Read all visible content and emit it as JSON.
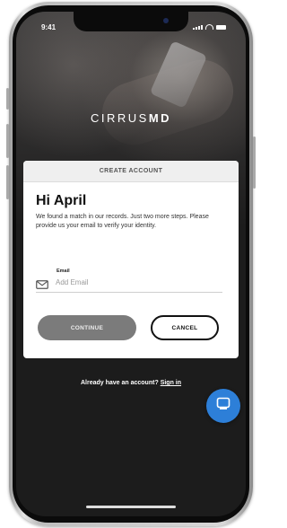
{
  "status_bar": {
    "time": "9:41"
  },
  "brand": {
    "logo_light": "CIRRUS",
    "logo_bold": "MD"
  },
  "card": {
    "header": "CREATE ACCOUNT",
    "greeting": "Hi April",
    "message": "We found a match in our records. Just two more steps. Please provide us your email to verify your identity.",
    "email": {
      "label": "Email",
      "placeholder": "Add Email",
      "value": ""
    },
    "continue_label": "CONTINUE",
    "cancel_label": "CANCEL"
  },
  "footer": {
    "signin_prompt": "Already have an account?",
    "signin_link": "Sign in"
  },
  "icons": {
    "email": "mail-icon",
    "chat": "chat-icon"
  },
  "colors": {
    "primary_button": "#7b7b7b",
    "chat_fab": "#2d7fd8",
    "background": "#1c1c1c"
  }
}
